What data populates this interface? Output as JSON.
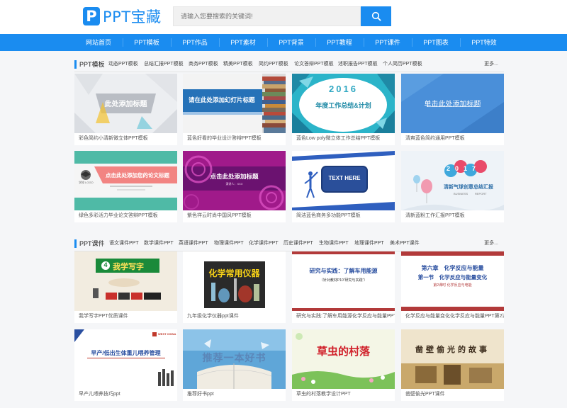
{
  "header": {
    "logo_mark": "P",
    "logo_text": "PPT宝藏",
    "search_placeholder": "请输入您要搜索的关键词!",
    "search_icon": "search-icon"
  },
  "nav": {
    "items": [
      "网站首页",
      "PPT模板",
      "PPT作品",
      "PPT素材",
      "PPT背景",
      "PPT教程",
      "PPT课件",
      "PPT图表",
      "PPT特效"
    ]
  },
  "section1": {
    "title": "PPT模板",
    "categories": [
      "动态PPT模板",
      "总结汇报PPT模板",
      "商务PPT模板",
      "精美PPT模板",
      "简约PPT模板",
      "论文答辩PPT模板",
      "述职报告PPT模板",
      "个人简历PPT模板"
    ],
    "more": "更多...",
    "cards": [
      {
        "caption": "彩色简约小清新微立体PPT模板",
        "thumb_text": "此处添加标题"
      },
      {
        "caption": "蓝色好看的毕业设计答辩PPT模板",
        "thumb_text": "请在此处添加幻灯片标题"
      },
      {
        "caption": "蓝色Low poly微立体工作总结PPT模板",
        "thumb_text": "年度工作总结&计划",
        "thumb_year": "2016"
      },
      {
        "caption": "清爽蓝色简约通用PPT模板",
        "thumb_text": "单击此处添加标题"
      },
      {
        "caption": "绿色多彩活力毕业论文答辩PPT模板",
        "thumb_text": "点击此处添加您的论文标题",
        "thumb_logo": "学校 LOGO"
      },
      {
        "caption": "紫色祥云时尚中国风PPT模板",
        "thumb_text": "点击此处添加标题",
        "thumb_sub": "演讲人：XXX"
      },
      {
        "caption": "简洁蓝色商务多功能PPT模板",
        "thumb_text": "TEXT HERE"
      },
      {
        "caption": "清新蓝粉工作汇报PPT模板",
        "thumb_text": "清新气球创意总结汇报",
        "thumb_year": "2017",
        "thumb_sub1": "BUSINESS",
        "thumb_sub2": "REPORT"
      }
    ]
  },
  "section2": {
    "title": "PPT课件",
    "categories": [
      "语文课件PPT",
      "数学课件PPT",
      "英语课件PPT",
      "物理课件PPT",
      "化学课件PPT",
      "历史课件PPT",
      "生物课件PPT",
      "地理课件PPT",
      "美术PPT课件"
    ],
    "more": "更多...",
    "cards": [
      {
        "caption": "我学写字PPT优质课件",
        "thumb_text": "我学写字",
        "thumb_num": "4"
      },
      {
        "caption": "九年级化学仪器ppt课件",
        "thumb_text": "化学常用仪器"
      },
      {
        "caption": "研究与实践:了解车用能源化学反应与能量PPT课件",
        "thumb_text": "研究与实践：了解车用能源",
        "thumb_sub": "（针对教材P10“研究与实践”）"
      },
      {
        "caption": "化学反应与能量变化化学反应与能量PPT第2课时",
        "thumb_text": "第六章　化学反应与能量",
        "thumb_sub": "第一节　化学反应与能量变化",
        "thumb_sub2": "第2课时 化学反应与电能"
      },
      {
        "caption": "早产儿喂养技巧ppt",
        "thumb_text": "早产/低出生体重儿喂养管理",
        "thumb_sub": "WEST CHINA"
      },
      {
        "caption": "推荐好书ppt",
        "thumb_text": "推荐一本好书"
      },
      {
        "caption": "草虫的村落教学设计PPT",
        "thumb_text": "草虫的村落"
      },
      {
        "caption": "凿壁偷光PPT课件",
        "thumb_text": "凿壁偷光的故事"
      }
    ]
  },
  "colors": {
    "accent": "#1a8cf0",
    "nav_sep": "#4aa6f5",
    "bg": "#f5f6f8"
  }
}
